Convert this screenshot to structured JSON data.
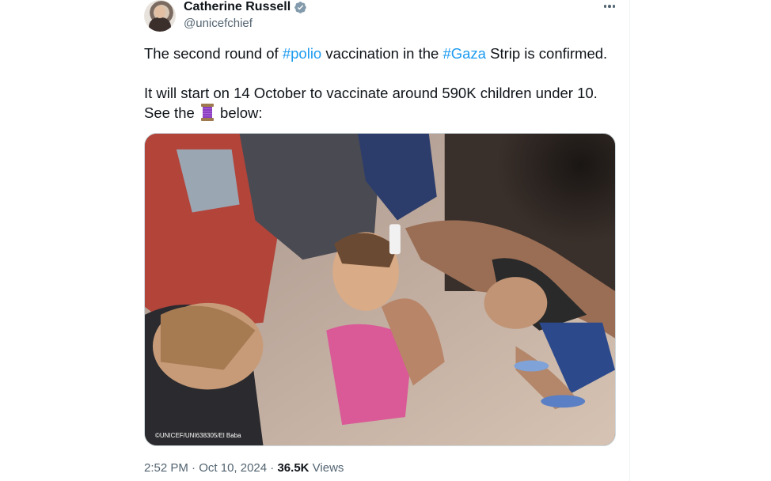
{
  "author": {
    "display_name": "Catherine Russell",
    "handle": "@unicefchief",
    "verified_icon": "verified-badge-icon",
    "avatar": "avatar"
  },
  "more_icon": "more-horizontal-icon",
  "tweet": {
    "line1": {
      "t1": "The second round of ",
      "tag1": "#polio",
      "t2": " vaccination in the ",
      "tag2": "#Gaza",
      "t3": " Strip is confirmed."
    },
    "line2": "It will start on 14 October to vaccinate around 590K children under 10.",
    "line3": {
      "t1": "See the ",
      "emoji": "thread-emoji",
      "t2": " below:"
    }
  },
  "media": {
    "credit": "©UNICEF/UNI638305/El Baba"
  },
  "meta": {
    "time": "2:52 PM",
    "sep1": " · ",
    "date": "Oct 10, 2024",
    "sep2": " · ",
    "views_count": "36.5K",
    "views_label": " Views"
  },
  "colors": {
    "link": "#1d9bf0",
    "text": "#0f1419",
    "secondary": "#536471",
    "verified": "#829aab"
  }
}
